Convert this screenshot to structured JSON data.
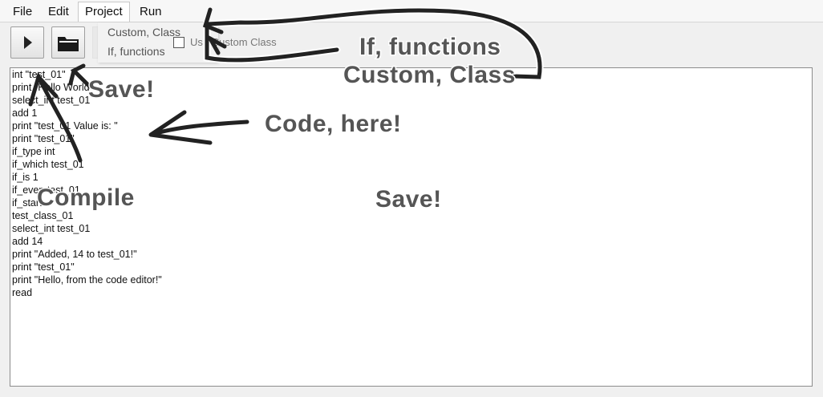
{
  "menu": {
    "items": [
      {
        "id": "file",
        "label": "File"
      },
      {
        "id": "edit",
        "label": "Edit"
      },
      {
        "id": "project",
        "label": "Project"
      },
      {
        "id": "run",
        "label": "Run"
      }
    ],
    "active": "project"
  },
  "toolbar": {
    "run_icon": "play-icon",
    "save_icon": "folder-icon",
    "dropdown_items": [
      "Custom, Class",
      "If, functions"
    ],
    "checkbox_label": "Use Custom Class",
    "checkbox_checked": false
  },
  "editor": {
    "lines": [
      "int \"test_01\"",
      "print \"Hello World\"",
      "select_int test_01",
      "add 1",
      "print \"test_01 Value is: \"",
      "print \"test_01\"",
      "if_type int",
      "if_which test_01",
      "if_is 1",
      "if_even test_01",
      "if_start",
      "test_class_01",
      "select_int test_01",
      "add 14",
      "print \"Added, 14 to test_01!\"",
      "print \"test_01\"",
      "print \"Hello, from the code editor!\"",
      "read"
    ]
  },
  "annotations": {
    "functions_label": "If, functions",
    "class_label": "Custom, Class",
    "save_label_1": "Save!",
    "code_label": "Code, here!",
    "compile_label": "Compile",
    "save_label_2": "Save!",
    "color": "#555555"
  },
  "colors": {
    "menubar_bg": "#f7f7f7",
    "window_bg": "#f0f0f0",
    "editor_bg": "#ffffff"
  }
}
